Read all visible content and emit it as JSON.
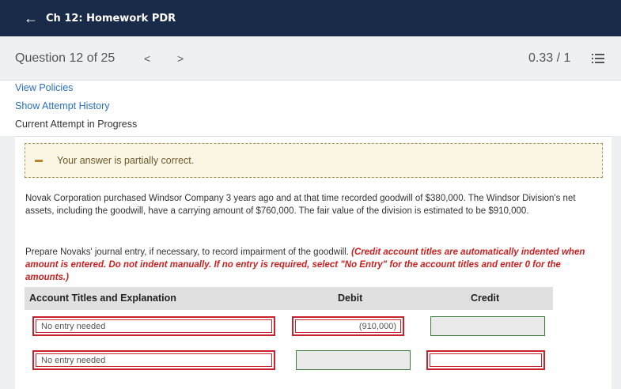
{
  "header": {
    "title": "Ch 12: Homework PDR",
    "back_icon": "arrow-left-icon"
  },
  "question_bar": {
    "label": "Question 12 of 25",
    "prev": "<",
    "next": ">",
    "score": "0.33 / 1"
  },
  "links": {
    "view_policies": "View Policies",
    "show_attempt_history": "Show Attempt History",
    "current_attempt": "Current Attempt in Progress"
  },
  "notice": {
    "text": "Your answer is partially correct."
  },
  "problem": {
    "text": "Novak Corporation purchased Windsor Company 3 years ago and at that time recorded goodwill of $380,000. The Windsor Division's net assets, including the goodwill, have a carrying amount of $760,000. The fair value of the division is estimated to be $910,000.",
    "prompt": "Prepare Novaks' journal entry, if necessary, to record impairment of the goodwill.",
    "instructions": "(Credit account titles are automatically indented when amount is entered. Do not indent manually. If no entry is required, select \"No Entry\" for the account titles and enter 0 for the amounts.)"
  },
  "table": {
    "headers": [
      "Account Titles and Explanation",
      "Debit",
      "Credit"
    ],
    "rows": [
      {
        "account": "No entry needed",
        "debit": "(910,000)",
        "credit": ""
      },
      {
        "account": "No entry needed",
        "debit": "",
        "credit": ""
      }
    ]
  },
  "colors": {
    "header_bg": "#1a2b4a",
    "link": "#2a6fb8",
    "error": "#c8232c",
    "correct": "#3e7c3e"
  }
}
